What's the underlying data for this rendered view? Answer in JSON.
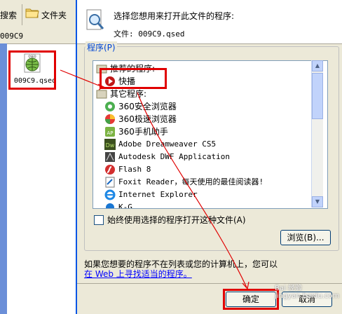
{
  "explorer": {
    "search_label": "搜索",
    "folders_label": "文件夹",
    "address": "009C9",
    "file_name": "009C9.qsed",
    "file_icon_text": "QSED"
  },
  "dialog": {
    "prompt": "选择您想用来打开此文件的程序:",
    "file_label": "文件: 009C9.qsed",
    "programs_group": "程序(P)",
    "recommended_header": "推荐的程序:",
    "other_header": "其它程序:",
    "recommended_items": [
      {
        "label": "快播",
        "icon": "qvod-play-icon"
      }
    ],
    "other_items": [
      {
        "label": "360安全浏览器",
        "icon": "360-browser-icon"
      },
      {
        "label": "360极速浏览器",
        "icon": "360-chrome-icon"
      },
      {
        "label": "360手机助手",
        "icon": "360-mobile-icon"
      },
      {
        "label": "Adobe Dreamweaver CS5",
        "icon": "dreamweaver-icon"
      },
      {
        "label": "Autodesk DWF Application",
        "icon": "autodesk-icon"
      },
      {
        "label": "Flash 8",
        "icon": "flash-icon"
      },
      {
        "label": "Foxit Reader，每天使用的最佳阅读器!",
        "icon": "foxit-icon"
      },
      {
        "label": "Internet Explorer",
        "icon": "ie-icon"
      },
      {
        "label": "K-G...",
        "icon": "app-icon"
      }
    ],
    "always_use_label": "始终使用选择的程序打开这种文件(A)",
    "browse_label": "浏览(B)...",
    "hint_text": "如果您想要的程序不在列表或您的计算机上，您可以",
    "web_link": "在 Web 上寻找适当的程序。",
    "ok_label": "确定",
    "cancel_label": "取消"
  },
  "watermark": "Bai 经验 jingyan.baidu.com",
  "colors": {
    "annotation_red": "#e00000",
    "dialog_bg": "#ece9d8",
    "link_blue": "#0000ff"
  }
}
